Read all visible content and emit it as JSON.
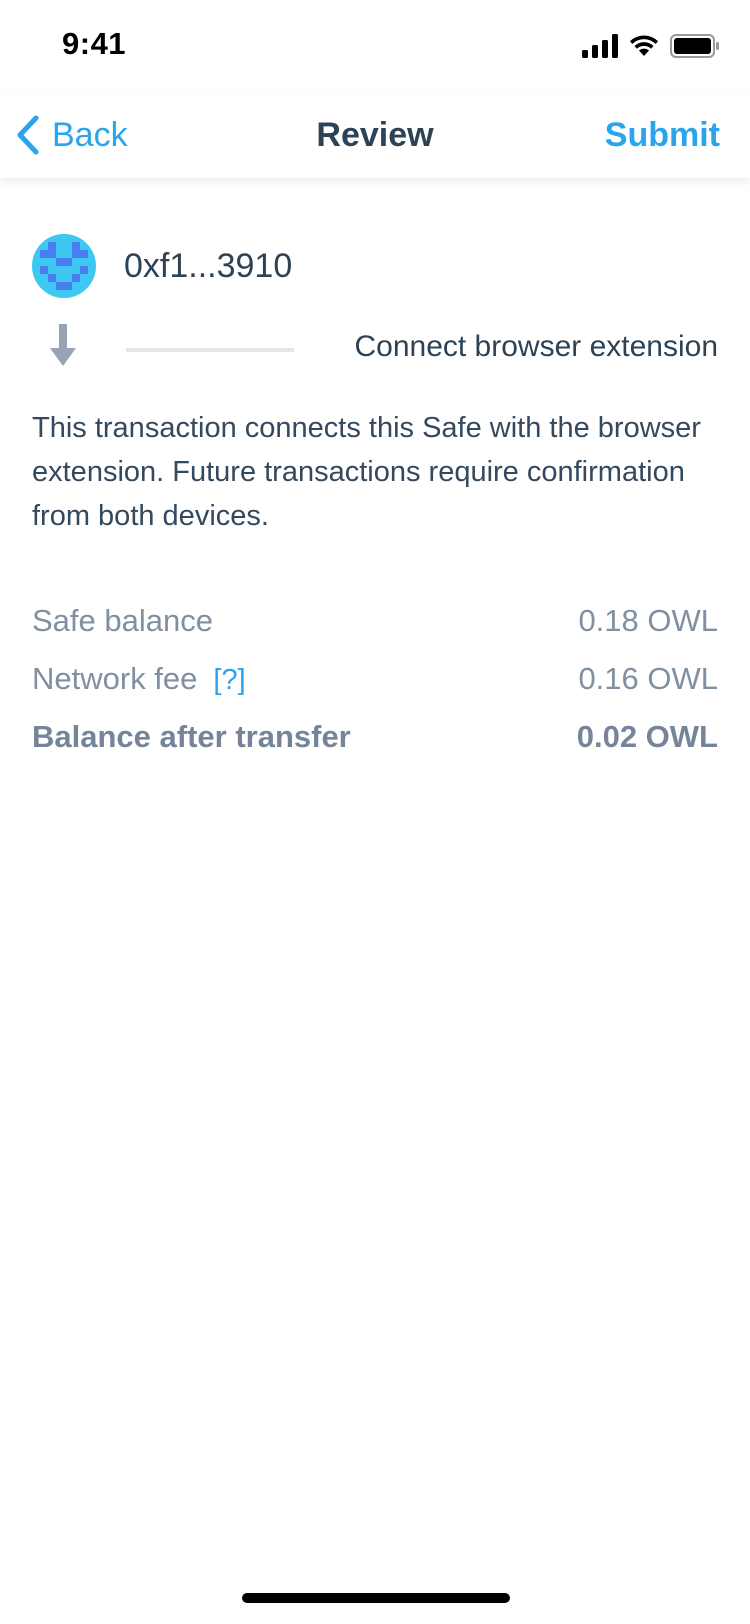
{
  "status_bar": {
    "time": "9:41",
    "icons": [
      "cellular-signal-icon",
      "wifi-icon",
      "battery-icon"
    ]
  },
  "nav": {
    "back_label": "Back",
    "title": "Review",
    "submit_label": "Submit"
  },
  "sender": {
    "address": "0xf1...3910",
    "avatar_icon": "identicon"
  },
  "transaction": {
    "direction_icon": "arrow-down-icon",
    "action_label": "Connect browser extension",
    "description": "This transaction connects this Safe with the browser extension. Future transactions require confirmation from both devices."
  },
  "balances": {
    "safe_balance_label": "Safe balance",
    "safe_balance_value": "0.18 OWL",
    "network_fee_label": "Network fee",
    "network_fee_help": "[?]",
    "network_fee_value": "0.16 OWL",
    "after_transfer_label": "Balance after transfer",
    "after_transfer_value": "0.02 OWL"
  },
  "colors": {
    "accent": "#2ba4ee",
    "primary_text": "#2d4355",
    "secondary_text": "#8090a0",
    "identicon_base": "#3cc8f0",
    "identicon_pattern": "#4a7ef0"
  }
}
